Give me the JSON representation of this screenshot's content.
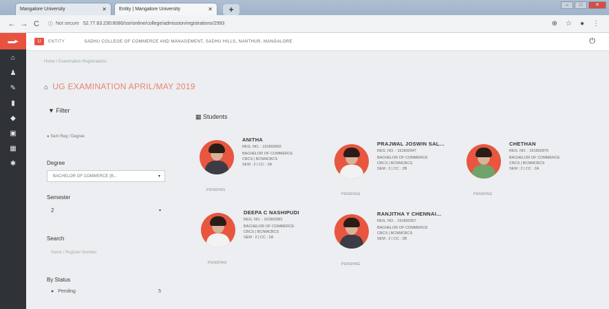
{
  "browser": {
    "tabs": [
      {
        "label": "Mangalore University"
      },
      {
        "label": "Entity | Mangalore University"
      }
    ],
    "new_tab": "+",
    "window_buttons": [
      "–",
      "□",
      "✕"
    ],
    "url_secure": "Not secure",
    "url": "52.77.63.230:8080/ssr/online/college/admission/registrations/2993"
  },
  "header": {
    "logo_text": "U",
    "brand": "ENTITY",
    "college": "SADHU COLLEGE OF COMMERCE AND MANAGEMENT, SADHU HILLS, NANTHUR, MANGALORE"
  },
  "breadcrumb": "Home  /  Examination Registrations",
  "page_title": "UG EXAMINATION APRIL/MAY 2019",
  "filter": {
    "heading": "Filter",
    "scheme": "Sem Reg  /  Degree",
    "degree_label": "Degree",
    "degree_value": "BACHELOR OF COMMERCE (B...",
    "semester_label": "Semester",
    "semester_value": "2",
    "search_label": "Search",
    "search_placeholder": "Name / Register Number",
    "status_label": "By Status",
    "status_item": "Pending",
    "status_count": "5"
  },
  "students_heading": "Students",
  "students": [
    {
      "name": "ANITHA",
      "reg": "REG. NO. : 191892802",
      "degree": "BACHELOR OF COMMERCE",
      "code": "CBCS | BCNMCBCS",
      "sem": "SEM : 2 | CC : 2A",
      "status": "PENDING"
    },
    {
      "name": "PRAJWAL JOSWIN SAL...",
      "reg": "REG. NO. : 191892947",
      "degree": "BACHELOR OF COMMERCE",
      "code": "CBCS | BCNMCBCS",
      "sem": "SEM : 2 | CC : 2B",
      "status": "PENDING"
    },
    {
      "name": "CHETHAN",
      "reg": "REG. NO. : 191892879",
      "degree": "BACHELOR OF COMMERCE",
      "code": "CBCS | BCNMCBCS",
      "sem": "SEM : 2 | CC : 2A",
      "status": "PENDING"
    },
    {
      "name": "DEEPA C NASHIPUDI",
      "reg": "REG. NO. : 191892881",
      "degree": "BACHELOR OF COMMERCE",
      "code": "CBCS | BCNMCBCS",
      "sem": "SEM : 2 | CC : 2A",
      "status": "PENDING"
    },
    {
      "name": "RANJITHA Y CHENNAI...",
      "reg": "REG. NO. : 191893357",
      "degree": "BACHELOR OF COMMERCE",
      "code": "CBCS | BCNMCBCS",
      "sem": "SEM : 2 | CC : 2B",
      "status": "PENDING"
    }
  ]
}
